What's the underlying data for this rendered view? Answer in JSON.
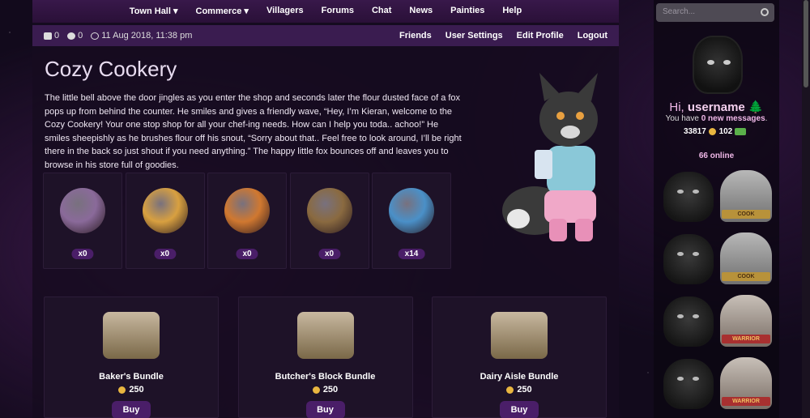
{
  "nav": [
    "Town Hall",
    "Commerce",
    "Villagers",
    "Forums",
    "Chat",
    "News",
    "Painties",
    "Help"
  ],
  "nav_dropdown": [
    true,
    true,
    false,
    false,
    false,
    false,
    false,
    false
  ],
  "status": {
    "mail_count": "0",
    "alert_count": "0",
    "datetime": "11 Aug 2018, 11:38 pm"
  },
  "subnav": [
    "Friends",
    "User Settings",
    "Edit Profile",
    "Logout"
  ],
  "shop": {
    "title": "Cozy Cookery",
    "description": "The little bell above the door jingles as you enter the shop and seconds later the flour dusted face of a fox pops up from behind the counter. He smiles and gives a friendly wave, “Hey, I’m Kieran, welcome to the Cozy Cookery! Your one stop shop for all your chef-ing needs. How can I help you toda.. achoo!” He smiles sheepishly as he brushes flour off his snout, “Sorry about that.. Feel free to look around, I’ll be right there in the back so just shout if you need anything.” The happy little fox bounces off and leaves you to browse in his store full of goodies.",
    "items": [
      {
        "icon": "purple-cookie-icon",
        "count": "x0",
        "color": "#8a6a9a"
      },
      {
        "icon": "winged-coin-cookie-icon",
        "count": "x0",
        "color": "#d8a040"
      },
      {
        "icon": "sun-pie-icon",
        "count": "x0",
        "color": "#d07830"
      },
      {
        "icon": "cookie-basket-icon",
        "count": "x0",
        "color": "#8a6a40"
      },
      {
        "icon": "blue-snowflake-cookie-icon",
        "count": "x14",
        "color": "#4a90c8"
      }
    ],
    "bundles": [
      {
        "name": "Baker's Bundle",
        "price": "250",
        "buy": "Buy",
        "icon": "flour-sugar-bags-icon"
      },
      {
        "name": "Butcher's Block Bundle",
        "price": "250",
        "buy": "Buy",
        "icon": "meat-block-icon"
      },
      {
        "name": "Dairy Aisle Bundle",
        "price": "250",
        "buy": "Buy",
        "icon": "milk-cheese-butter-icon"
      }
    ]
  },
  "sidebar": {
    "search_placeholder": "Search...",
    "greeting": "Hi, ",
    "username": "username",
    "messages_pre": "You have ",
    "messages_count": "0 new messages",
    "messages_post": ".",
    "coins": "33817",
    "gems": "102",
    "online": "66 online",
    "online_users": [
      {
        "crest": "COOK",
        "type": "cook"
      },
      {
        "crest": "COOK",
        "type": "cook"
      },
      {
        "crest": "WARRIOR",
        "type": "war"
      },
      {
        "crest": "WARRIOR",
        "type": "war"
      }
    ]
  }
}
